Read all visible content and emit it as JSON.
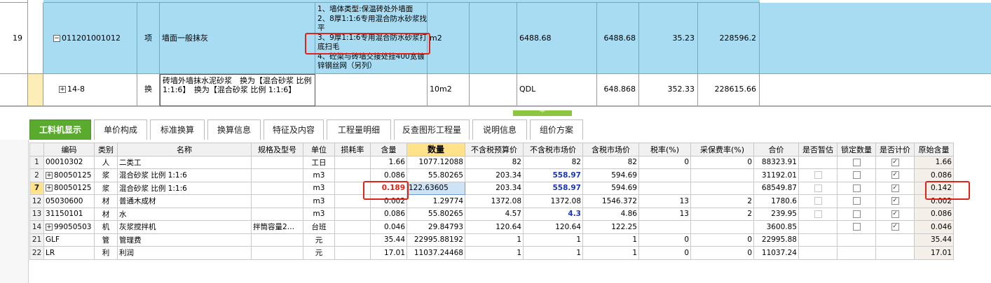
{
  "top_rows": {
    "row19": {
      "index": "19",
      "collapse_glyph": "−",
      "code": "011201001012",
      "category": "项",
      "name": "墙面一般抹灰",
      "description": "1、墙体类型:保温砖处外墙面\n2、8厚1:1:6专用混合防水砂浆找平\n3、9厚1:1:6专用混合防水砂浆打底扫毛\n4、砼梁与砖墙交接处挂400宽镀锌钢丝网（另列）",
      "unit": "m2",
      "formula": "6488.68",
      "quantity": "6488.68",
      "unit_price": "35.23",
      "total": "228596.2"
    },
    "row_sub": {
      "expand_glyph": "+",
      "code": "14-8",
      "category": "换",
      "name": "砖墙外墙抹水泥砂浆　换为【混合砂浆 比例 1:1:6】　换为【混合砂浆 比例 1:1:6】",
      "unit": "10m2",
      "formula": "QDL",
      "quantity": "648.868",
      "unit_price": "352.33",
      "total": "228615.66"
    }
  },
  "splitter_glyph": "︾",
  "tabs": [
    {
      "label": "工料机显示",
      "active": true
    },
    {
      "label": "单价构成"
    },
    {
      "label": "标准换算"
    },
    {
      "label": "换算信息"
    },
    {
      "label": "特征及内容"
    },
    {
      "label": "工程量明细"
    },
    {
      "label": "反查图形工程量"
    },
    {
      "label": "说明信息"
    },
    {
      "label": "组价方案"
    }
  ],
  "grid": {
    "headers": [
      "编码",
      "类别",
      "名称",
      "规格及型号",
      "单位",
      "损耗率",
      "含量",
      "数量",
      "不含税预算价",
      "不含税市场价",
      "含税市场价",
      "税率(%)",
      "采保费率(%)",
      "合价",
      "是否暂估",
      "锁定数量",
      "是否计价",
      "原始含量"
    ],
    "rows": [
      {
        "seq": "1",
        "code": "00010302",
        "type": "人",
        "name": "二类工",
        "spec": "",
        "unit": "工日",
        "loss": "",
        "content": "1.66",
        "qty": "1077.12088",
        "budget": "82",
        "market": "82",
        "tax_market": "82",
        "tax_rate": "0",
        "fee_rate": "0",
        "total": "88323.91",
        "est": "",
        "lock": "☐",
        "priced": "☑",
        "orig": "1.66"
      },
      {
        "seq": "2",
        "code": "80050125",
        "type": "浆",
        "name": "混合砂浆 比例 1:1:6",
        "spec": "",
        "unit": "m3",
        "loss": "",
        "content": "0.086",
        "qty": "55.80265",
        "budget": "203.34",
        "market": "558.97",
        "tax_market": "594.69",
        "tax_rate": "",
        "fee_rate": "",
        "total": "31192.01",
        "est": "☐",
        "lock": "☐",
        "priced": "☑",
        "orig": "0.086"
      },
      {
        "seq": "7",
        "code": "80050125",
        "type": "浆",
        "name": "混合砂浆 比例 1:1:6",
        "spec": "",
        "unit": "m3",
        "loss": "",
        "content": "0.189",
        "qty": "122.63605",
        "budget": "203.34",
        "market": "558.97",
        "tax_market": "594.69",
        "tax_rate": "",
        "fee_rate": "",
        "total": "68549.87",
        "est": "☐",
        "lock": "☐",
        "priced": "☑",
        "orig": "0.142"
      },
      {
        "seq": "12",
        "code": "05030600",
        "type": "材",
        "name": "普通木成材",
        "spec": "",
        "unit": "m3",
        "loss": "",
        "content": "0.002",
        "qty": "1.29774",
        "budget": "1372.08",
        "market": "1372.08",
        "tax_market": "1546.372",
        "tax_rate": "13",
        "fee_rate": "2",
        "total": "1780.6",
        "est": "☐",
        "lock": "☐",
        "priced": "☑",
        "orig": "0.002"
      },
      {
        "seq": "13",
        "code": "31150101",
        "type": "材",
        "name": "水",
        "spec": "",
        "unit": "m3",
        "loss": "",
        "content": "0.086",
        "qty": "55.80265",
        "budget": "4.57",
        "market": "4.3",
        "tax_market": "4.86",
        "tax_rate": "13",
        "fee_rate": "2",
        "total": "239.95",
        "est": "☐",
        "lock": "☐",
        "priced": "☑",
        "orig": "0.086"
      },
      {
        "seq": "14",
        "code": "99050503",
        "type": "机",
        "name": "灰浆搅拌机",
        "spec": "拌筒容量2…",
        "unit": "台班",
        "loss": "",
        "content": "0.046",
        "qty": "29.84793",
        "budget": "120.64",
        "market": "120.64",
        "tax_market": "122.25",
        "tax_rate": "",
        "fee_rate": "",
        "total": "3600.85",
        "est": "",
        "lock": "☐",
        "priced": "☑",
        "orig": "0.046"
      },
      {
        "seq": "21",
        "code": "GLF",
        "type": "管",
        "name": "管理费",
        "spec": "",
        "unit": "元",
        "loss": "",
        "content": "35.44",
        "qty": "22995.88192",
        "budget": "1",
        "market": "1",
        "tax_market": "1",
        "tax_rate": "0",
        "fee_rate": "0",
        "total": "22995.88",
        "est": "",
        "lock": "",
        "priced": "",
        "orig": "35.44"
      },
      {
        "seq": "22",
        "code": "LR",
        "type": "利",
        "name": "利润",
        "spec": "",
        "unit": "元",
        "loss": "",
        "content": "17.01",
        "qty": "11037.24468",
        "budget": "1",
        "market": "1",
        "tax_market": "1",
        "tax_rate": "0",
        "fee_rate": "0",
        "total": "11037.24",
        "est": "",
        "lock": "",
        "priced": "",
        "orig": "17.01"
      }
    ]
  },
  "colors": {
    "selected_row": "#a8dcf2",
    "active_tab": "#5aaa2e",
    "highlight_header": "#ffe28a",
    "annotation": "#e2231a",
    "market_price": "#1a35b8"
  }
}
